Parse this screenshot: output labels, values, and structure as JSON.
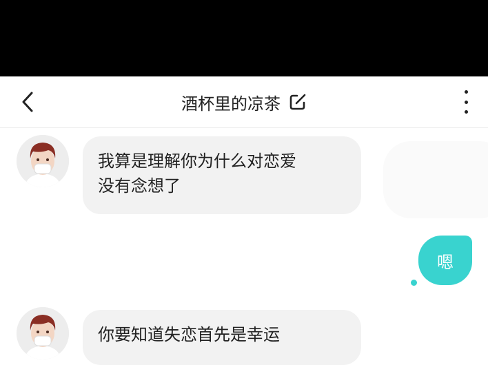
{
  "header": {
    "title": "酒杯里的凉茶"
  },
  "messages": [
    {
      "side": "left",
      "text_line1": "我算是理解你为什么对恋爱",
      "text_line2": "没有念想了"
    },
    {
      "side": "right",
      "text": "嗯"
    },
    {
      "side": "left",
      "text_line1": "你要知道失恋首先是幸运"
    }
  ],
  "colors": {
    "accent": "#39d3cf",
    "incoming_bubble": "#f2f2f2",
    "status_bar": "#000000"
  },
  "icons": [
    "chevron-left-icon",
    "edit-icon",
    "more-vertical-icon",
    "avatar-icon"
  ]
}
